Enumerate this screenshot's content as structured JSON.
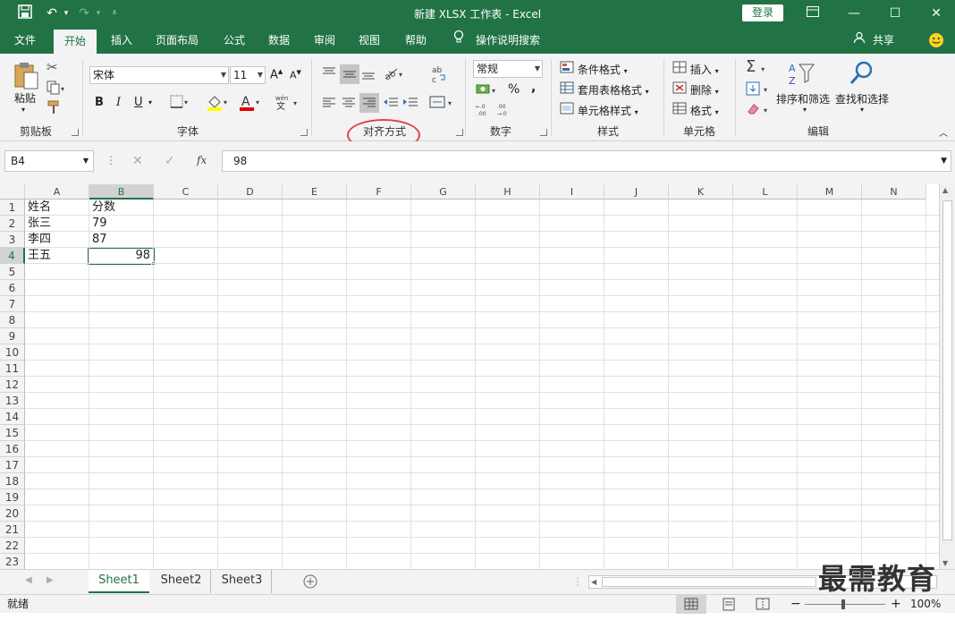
{
  "titlebar": {
    "title": "新建 XLSX 工作表  -  Excel",
    "login_label": "登录",
    "save_icon": "save-icon",
    "undo_icon": "undo-icon",
    "redo_icon": "redo-icon"
  },
  "tabs": [
    {
      "label": "文件"
    },
    {
      "label": "开始"
    },
    {
      "label": "插入"
    },
    {
      "label": "页面布局"
    },
    {
      "label": "公式"
    },
    {
      "label": "数据"
    },
    {
      "label": "审阅"
    },
    {
      "label": "视图"
    },
    {
      "label": "帮助"
    },
    {
      "label": "操作说明搜索"
    }
  ],
  "share_label": "共享",
  "ribbon": {
    "clipboard": {
      "paste_label": "粘贴",
      "group_label": "剪贴板"
    },
    "font": {
      "font_name": "宋体",
      "font_size": "11",
      "group_label": "字体",
      "bold": "B",
      "italic": "I",
      "underline": "U"
    },
    "alignment": {
      "group_label": "对齐方式"
    },
    "number": {
      "format": "常规",
      "percent": "%",
      "comma": ",",
      "group_label": "数字"
    },
    "styles": {
      "conditional": "条件格式",
      "table": "套用表格格式",
      "cell_styles": "单元格样式",
      "group_label": "样式"
    },
    "cells": {
      "insert": "插入",
      "delete": "删除",
      "format": "格式",
      "group_label": "单元格"
    },
    "editing": {
      "sort_filter": "排序和筛选",
      "find_select": "查找和选择",
      "group_label": "编辑"
    }
  },
  "formula_bar": {
    "name_box": "B4",
    "fx": "fx",
    "value": "98"
  },
  "columns": [
    "A",
    "B",
    "C",
    "D",
    "E",
    "F",
    "G",
    "H",
    "I",
    "J",
    "K",
    "L",
    "M",
    "N"
  ],
  "rows": [
    "1",
    "2",
    "3",
    "4",
    "5",
    "6",
    "7",
    "8",
    "9",
    "10",
    "11",
    "12",
    "13",
    "14",
    "15",
    "16",
    "17",
    "18",
    "19",
    "20",
    "21",
    "22",
    "23"
  ],
  "cells": {
    "A1": "姓名",
    "B1": "分数",
    "A2": "张三",
    "B2": "79",
    "A3": "李四",
    "B3": "87",
    "A4": "王五",
    "B4": "98"
  },
  "sheets": [
    {
      "label": "Sheet1"
    },
    {
      "label": "Sheet2"
    },
    {
      "label": "Sheet3"
    }
  ],
  "status": {
    "ready": "就绪",
    "zoom": "100%"
  },
  "watermark": "最需教育",
  "colors": {
    "accent": "#217346",
    "annotation": "#e04444"
  }
}
